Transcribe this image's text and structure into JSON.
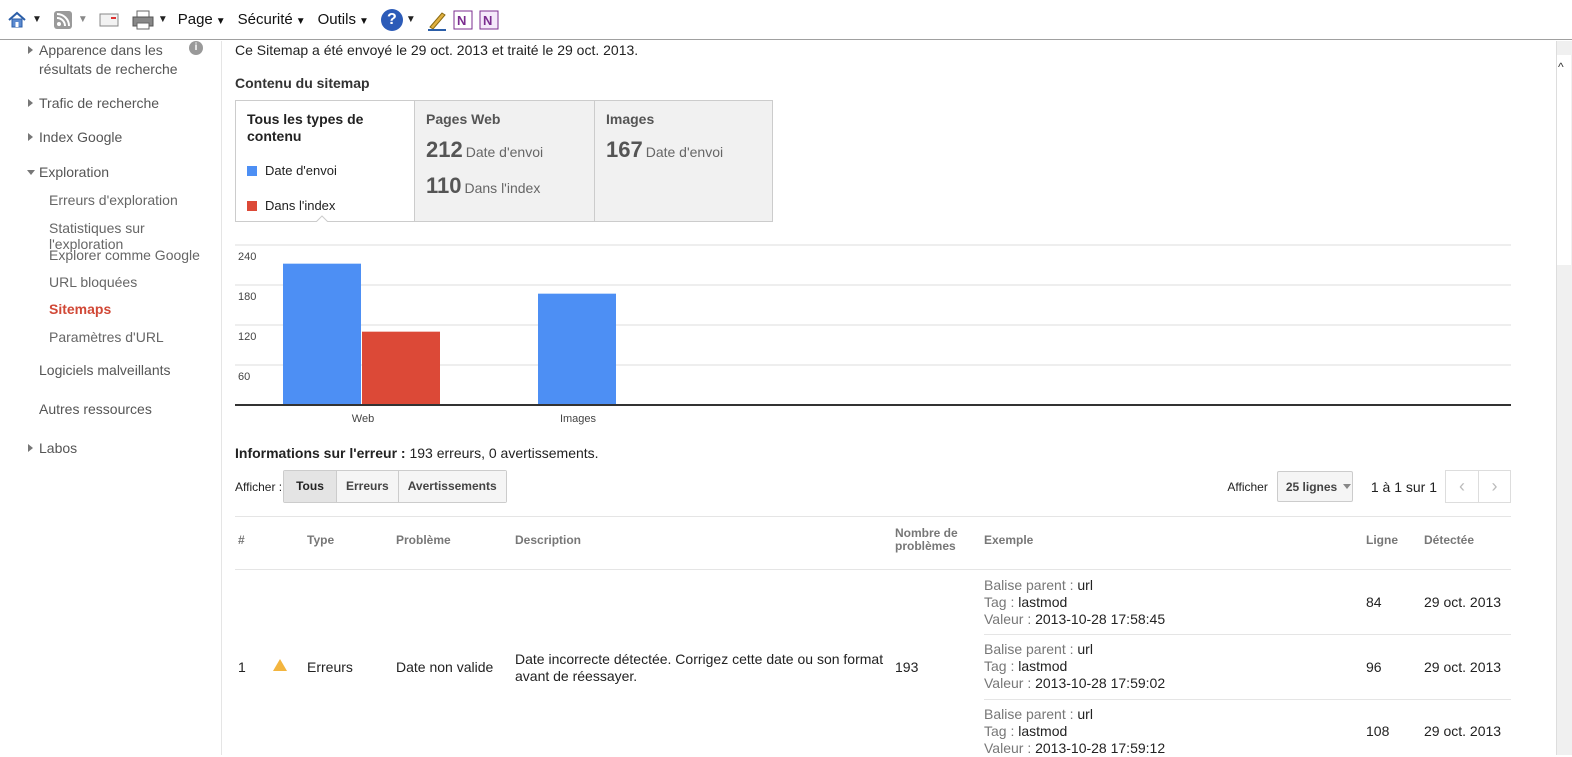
{
  "toolbar": {
    "menus": [
      "Page",
      "Sécurité",
      "Outils"
    ]
  },
  "sidebar": {
    "appearance": "Apparence dans les résultats de recherche",
    "items": [
      "Trafic de recherche",
      "Index Google",
      "Exploration"
    ],
    "sub_items": [
      "Erreurs d'exploration",
      "Statistiques sur l'exploration",
      "Explorer comme Google",
      "URL bloquées",
      "Sitemaps",
      "Paramètres d'URL"
    ],
    "bottom_items": [
      "Logiciels malveillants",
      "Autres ressources",
      "Labos"
    ]
  },
  "main": {
    "sent_line": "Ce Sitemap a été envoyé le 29 oct. 2013 et traité le 29 oct. 2013.",
    "section_title": "Contenu du sitemap",
    "content_box": {
      "all_types": "Tous les types de contenu",
      "legend_sent": "Date d'envoi",
      "legend_indexed": "Dans l'index",
      "web_head": "Pages Web",
      "web_sent_num": "212",
      "web_sent_lbl": "Date d'envoi",
      "web_idx_num": "110",
      "web_idx_lbl": "Dans l'index",
      "img_head": "Images",
      "img_sent_num": "167",
      "img_sent_lbl": "Date d'envoi"
    },
    "error_info_label": "Informations sur l'erreur :",
    "error_info_value": " 193 erreurs, 0 avertissements.",
    "filter": {
      "label": "Afficher :",
      "options": [
        "Tous",
        "Erreurs",
        "Avertissements"
      ],
      "rows_label": "Afficher",
      "rows_value": "25 lignes",
      "page_info": "1 à 1 sur 1"
    },
    "table": {
      "headers": {
        "num": "#",
        "type": "Type",
        "problem": "Problème",
        "description": "Description",
        "count": "Nombre de problèmes",
        "example": "Exemple",
        "line": "Ligne",
        "detected": "Détectée"
      },
      "row": {
        "num": "1",
        "type": "Erreurs",
        "problem": "Date non valide",
        "description": "Date incorrecte détectée. Corrigez cette date ou son format avant de réessayer.",
        "count": "193"
      },
      "examples": [
        {
          "parent_key": "Balise parent :",
          "parent": "url",
          "tag_key": "Tag :",
          "tag": "lastmod",
          "value_key": "Valeur :",
          "value": "2013-10-28 17:58:45",
          "line": "84",
          "detected": "29 oct. 2013"
        },
        {
          "parent_key": "Balise parent :",
          "parent": "url",
          "tag_key": "Tag :",
          "tag": "lastmod",
          "value_key": "Valeur :",
          "value": "2013-10-28 17:59:02",
          "line": "96",
          "detected": "29 oct. 2013"
        },
        {
          "parent_key": "Balise parent :",
          "parent": "url",
          "tag_key": "Tag :",
          "tag": "lastmod",
          "value_key": "Valeur :",
          "value": "2013-10-28 17:59:12",
          "line": "108",
          "detected": "29 oct. 2013"
        }
      ]
    }
  },
  "colors": {
    "blue": "#4d8ff4",
    "red": "#dc4937",
    "active_link": "#d14836"
  },
  "chart_data": {
    "type": "bar",
    "categories": [
      "Web",
      "Images"
    ],
    "series": [
      {
        "name": "Date d'envoi",
        "values": [
          212,
          167
        ]
      },
      {
        "name": "Dans l'index",
        "values": [
          110,
          null
        ]
      }
    ],
    "yticks": [
      60,
      120,
      180,
      240
    ],
    "ylim": [
      0,
      240
    ],
    "grid": true
  }
}
